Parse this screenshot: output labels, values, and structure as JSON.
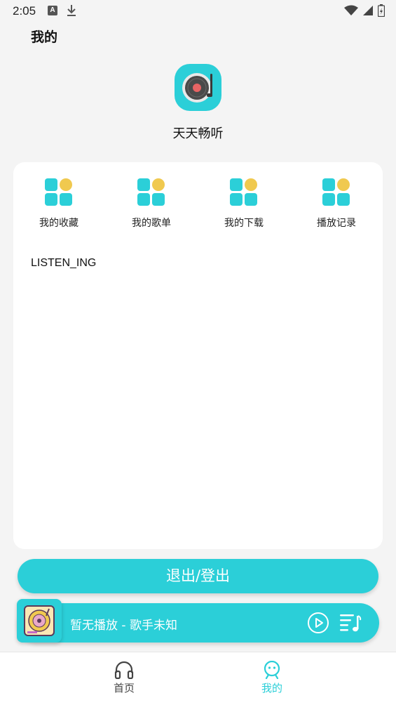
{
  "status_bar": {
    "time": "2:05",
    "notif_a": "A"
  },
  "header": {
    "title": "我的"
  },
  "app": {
    "name": "天天畅听"
  },
  "features": [
    {
      "label": "我的收藏",
      "icon": "grid-icon"
    },
    {
      "label": "我的歌单",
      "icon": "grid-icon"
    },
    {
      "label": "我的下载",
      "icon": "grid-icon"
    },
    {
      "label": "播放记录",
      "icon": "grid-icon"
    }
  ],
  "main": {
    "listen_label": "LISTEN_ING"
  },
  "logout": {
    "label": "退出/登出"
  },
  "player": {
    "now_playing": "暂无播放 - 歌手未知",
    "icons": [
      "play-icon",
      "playlist-icon"
    ]
  },
  "nav": [
    {
      "label": "首页",
      "icon": "headphones-icon",
      "active": false
    },
    {
      "label": "我的",
      "icon": "profile-icon",
      "active": true
    }
  ],
  "colors": {
    "accent": "#2bcfd8",
    "yellow": "#f0c94f",
    "background": "#f4f4f4",
    "inactive": "#444444"
  }
}
